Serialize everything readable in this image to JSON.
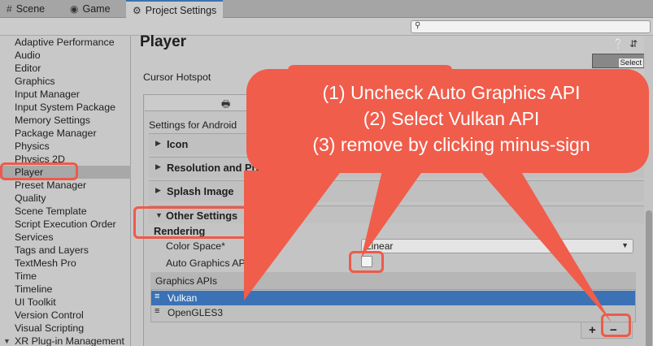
{
  "tabs": [
    {
      "label": "Scene",
      "icon": "grid-icon"
    },
    {
      "label": "Game",
      "icon": "gamepad-icon"
    },
    {
      "label": "Project Settings",
      "icon": "gear-icon"
    }
  ],
  "search": {
    "placeholder": ""
  },
  "sidebar": {
    "items": [
      {
        "label": "Adaptive Performance"
      },
      {
        "label": "Audio"
      },
      {
        "label": "Editor"
      },
      {
        "label": "Graphics"
      },
      {
        "label": "Input Manager"
      },
      {
        "label": "Input System Package"
      },
      {
        "label": "Memory Settings"
      },
      {
        "label": "Package Manager"
      },
      {
        "label": "Physics"
      },
      {
        "label": "Physics 2D"
      },
      {
        "label": "Player",
        "selected": true
      },
      {
        "label": "Preset Manager"
      },
      {
        "label": "Quality"
      },
      {
        "label": "Scene Template"
      },
      {
        "label": "Script Execution Order"
      },
      {
        "label": "Services"
      },
      {
        "label": "Tags and Layers"
      },
      {
        "label": "TextMesh Pro"
      },
      {
        "label": "Time"
      },
      {
        "label": "Timeline"
      },
      {
        "label": "UI Toolkit"
      },
      {
        "label": "Version Control"
      },
      {
        "label": "Visual Scripting"
      },
      {
        "label": "XR Plug-in Management"
      }
    ]
  },
  "header": {
    "title": "Player",
    "icons": [
      "help-icon",
      "preset-icon",
      "more-icon"
    ],
    "select_label": "Select"
  },
  "main": {
    "cursor_hotspot": "Cursor Hotspot",
    "settings_for": "Settings for Android",
    "sections": [
      {
        "label": "Icon"
      },
      {
        "label": "Resolution and Presentation"
      },
      {
        "label": "Splash Image"
      }
    ],
    "other_settings": "Other Settings",
    "rendering": "Rendering",
    "color_space_label": "Color Space*",
    "color_space_value": "Linear",
    "auto_graphics_label": "Auto Graphics API",
    "auto_graphics_checked": false,
    "graphics_apis_header": "Graphics APIs",
    "graphics_apis": [
      {
        "name": "Vulkan",
        "selected": true
      },
      {
        "name": "OpenGLES3",
        "selected": false
      }
    ],
    "plus": "+",
    "minus": "−"
  },
  "annotation": {
    "lines": [
      "(1) Uncheck Auto Graphics API",
      "(2) Select Vulkan API",
      "(3) remove by clicking minus-sign"
    ],
    "color": "#f05d4b"
  },
  "colors": {
    "selection_blue": "#3b72b6",
    "highlight_red": "#ee5a4a"
  }
}
